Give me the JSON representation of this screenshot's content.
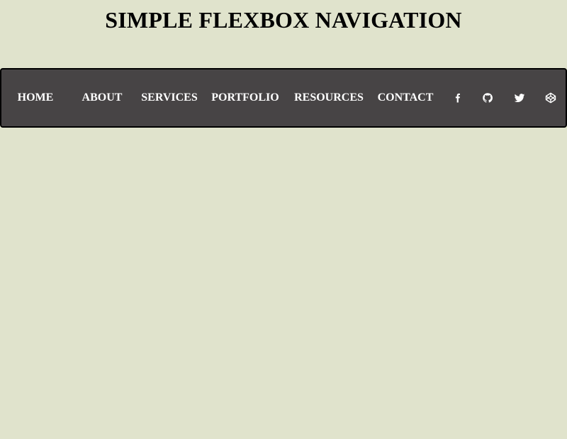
{
  "page": {
    "title": "SIMPLE FLEXBOX NAVIGATION"
  },
  "nav": {
    "links": [
      {
        "label": "HOME"
      },
      {
        "label": "ABOUT"
      },
      {
        "label": "SERVICES"
      },
      {
        "label": "PORTFOLIO"
      },
      {
        "label": "RESOURCES"
      },
      {
        "label": "CONTACT"
      }
    ],
    "social_icons": [
      "facebook-icon",
      "github-icon",
      "twitter-icon",
      "codepen-icon"
    ]
  },
  "colors": {
    "background": "#e0e3cc",
    "navbar": "#474445",
    "nav_text": "#ffffff"
  }
}
